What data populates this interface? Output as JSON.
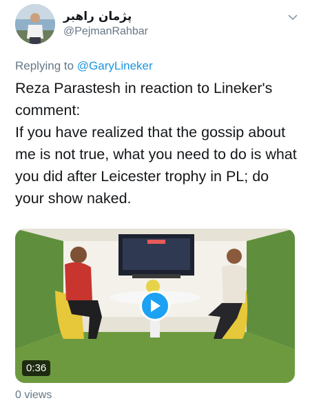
{
  "header": {
    "display_name": "پژمان راهبر",
    "handle": "@PejmanRahbar"
  },
  "reply": {
    "prefix": "Replying to",
    "mention": "@GaryLineker"
  },
  "tweet": {
    "paragraph_1": "Reza Parastesh in reaction to Lineker's comment:",
    "paragraph_2": "If you have realized that the gossip about me is not true, what you need to do is what you did after Leicester trophy in PL; do your show naked."
  },
  "media": {
    "duration": "0:36"
  },
  "footer": {
    "views": "0 views"
  },
  "colors": {
    "accent": "#1da1f2",
    "link": "#1b95e0",
    "muted": "#657786"
  },
  "icons": {
    "menu": "chevron-down-icon",
    "play": "play-icon"
  }
}
